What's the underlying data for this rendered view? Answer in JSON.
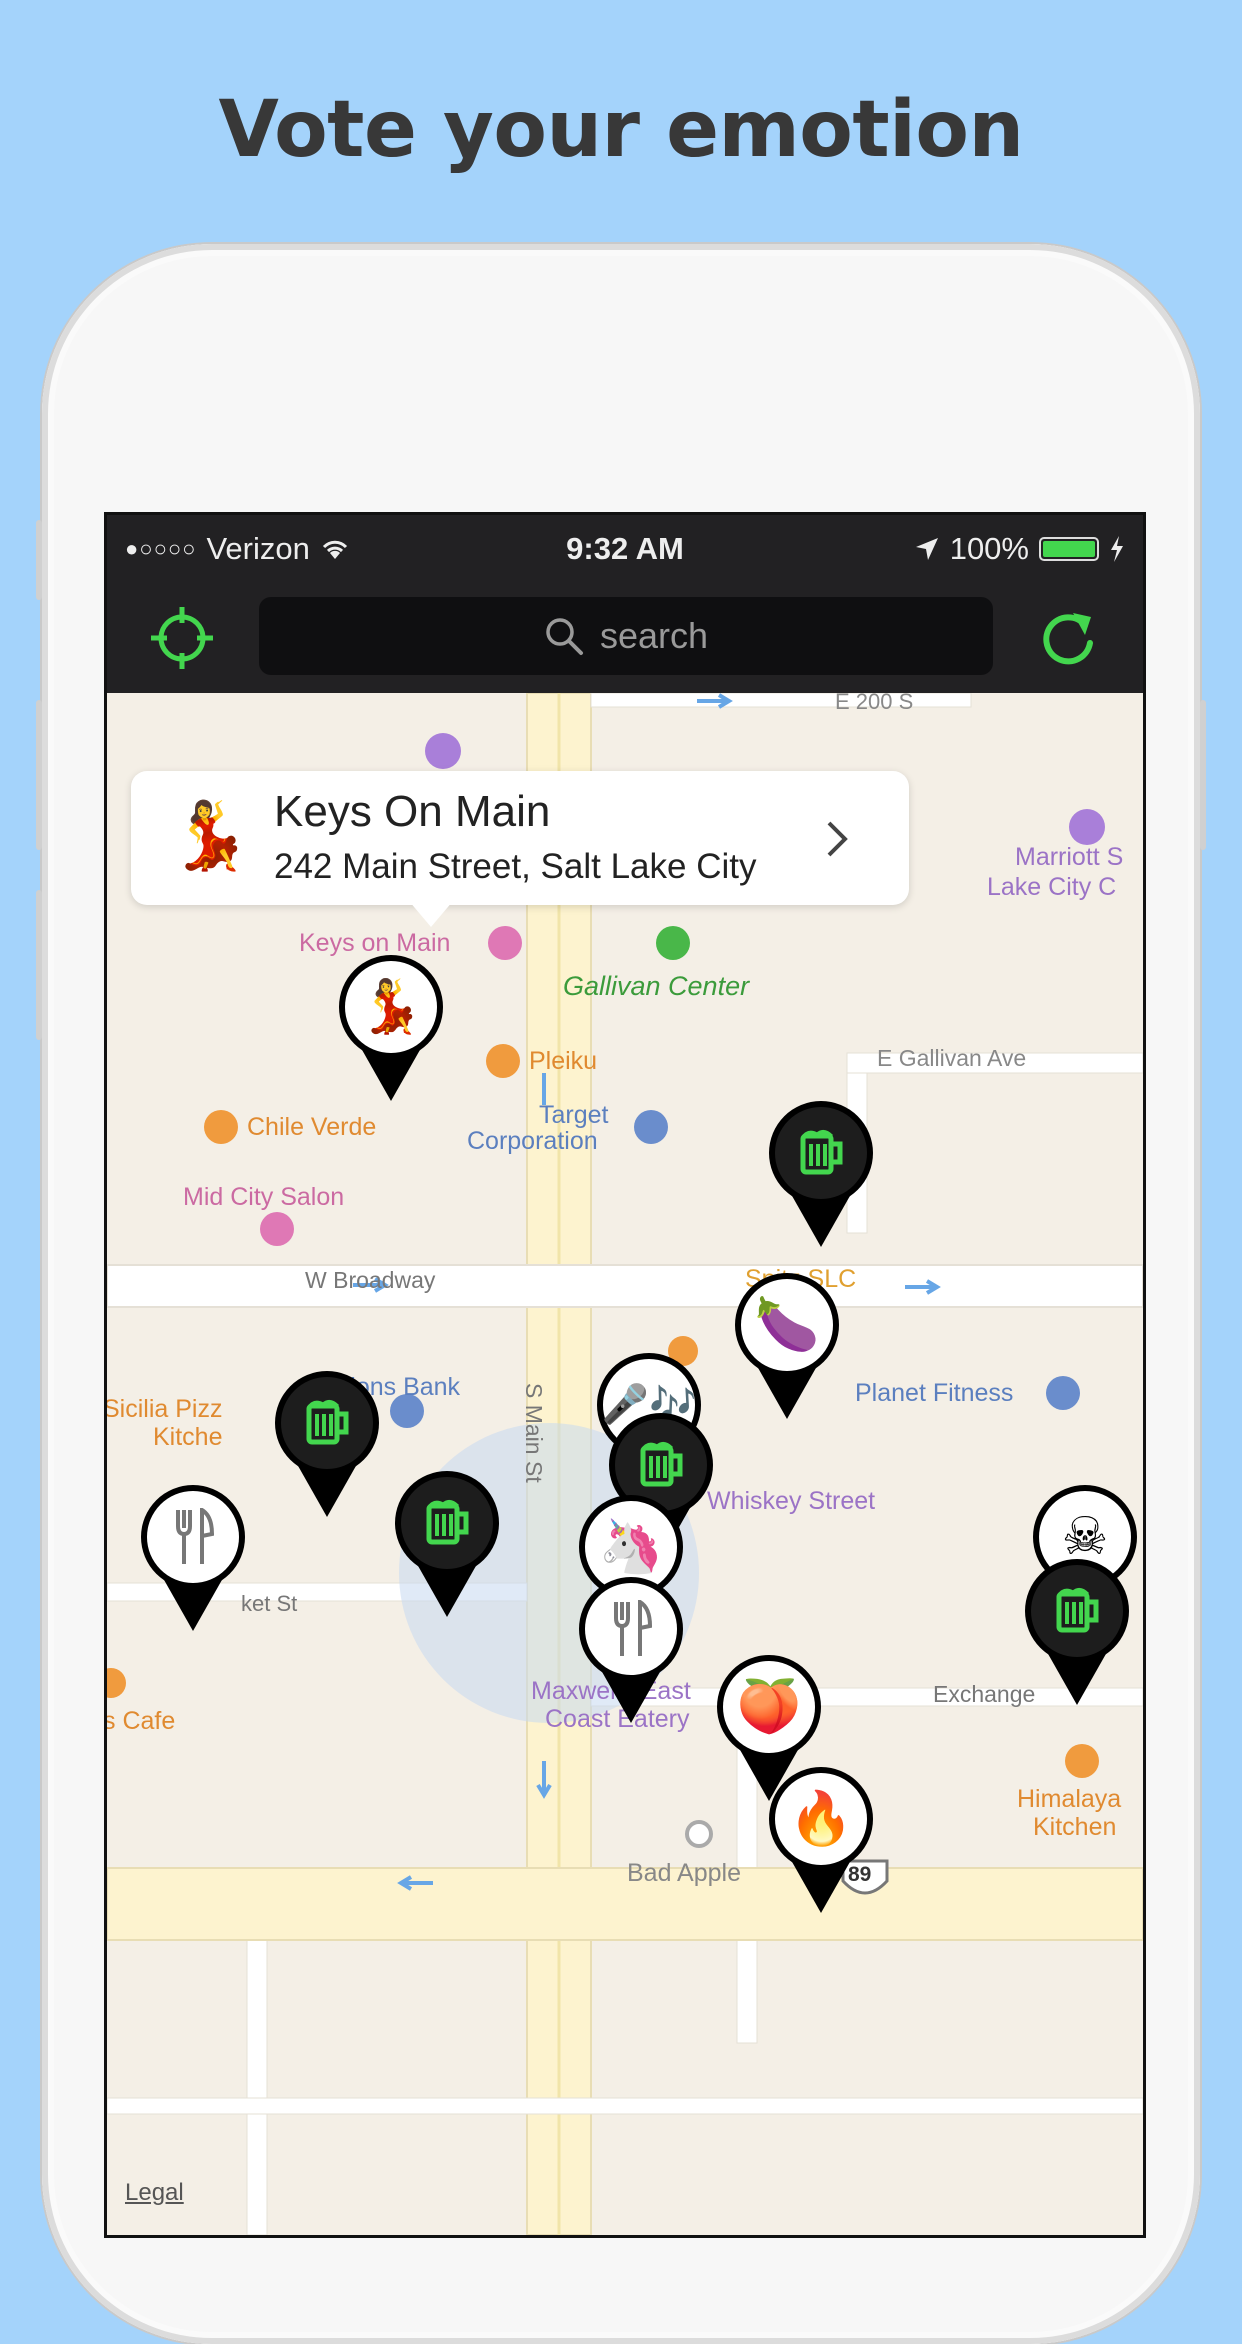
{
  "headline": "Vote your emotion",
  "status_bar": {
    "signal": "●○○○○",
    "carrier": "Verizon",
    "time": "9:32 AM",
    "battery": "100%",
    "battery_level": 1.0
  },
  "toolbar": {
    "locate_icon": "crosshair-icon",
    "search_placeholder": "search",
    "refresh_icon": "refresh-icon"
  },
  "callout": {
    "title": "Keys On Main",
    "address": "242 Main Street, Salt Lake City",
    "emoji": "💃"
  },
  "map": {
    "labels": {
      "street_top": "E 200 S",
      "marriott": "Marriott S",
      "lake_city": "Lake City C",
      "keys_on_main": "Keys on Main",
      "gallivan": "Gallivan Center",
      "pleiku": "Pleiku",
      "gallivan_ave": "E Gallivan Ave",
      "chile_verde": "Chile Verde",
      "target": "Target",
      "corporation": "Corporation",
      "mid_city_salon": "Mid City Salon",
      "w_broadway": "W Broadway",
      "spitz": "Spitz SLC",
      "zions_bank": "Zions Bank",
      "s_main_st": "S Main St",
      "sicilia": "Sicilia Pizz",
      "kitchen_left": "Kitche",
      "planet_fitness": "Planet Fitness",
      "whiskey_street": "Whiskey Street",
      "market_st": "ket St",
      "exchange": "Exchange",
      "cafe": "s Cafe",
      "maxwells": "Maxwells East",
      "coast_eatery": "Coast Eatery",
      "himalayan": "Himalaya",
      "himalayan_kitchen": "Kitchen",
      "bad_apple": "Bad Apple",
      "route": "89"
    },
    "legal": "Legal"
  },
  "pins": [
    {
      "id": "keys-on-main-pin",
      "emoji": "💃",
      "style": "white"
    },
    {
      "id": "beer-pin-1",
      "emoji": "beer",
      "style": "dark"
    },
    {
      "id": "eggplant-pin",
      "emoji": "🍆",
      "style": "white"
    },
    {
      "id": "beer-pin-2",
      "emoji": "beer",
      "style": "dark"
    },
    {
      "id": "music-pin",
      "emoji": "🎤🎶",
      "style": "white"
    },
    {
      "id": "beer-pin-3",
      "emoji": "beer",
      "style": "dark"
    },
    {
      "id": "unicorn-pin",
      "emoji": "🦄",
      "style": "white"
    },
    {
      "id": "fork-pin-1",
      "emoji": "fork",
      "style": "white"
    },
    {
      "id": "fork-pin-2",
      "emoji": "fork",
      "style": "white"
    },
    {
      "id": "beer-pin-4",
      "emoji": "beer",
      "style": "dark"
    },
    {
      "id": "peach-pin",
      "emoji": "🍑",
      "style": "white"
    },
    {
      "id": "fire-pin",
      "emoji": "🔥",
      "style": "white"
    },
    {
      "id": "skull-pin",
      "emoji": "☠",
      "style": "white"
    },
    {
      "id": "beer-pin-5",
      "emoji": "beer",
      "style": "dark"
    }
  ],
  "colors": {
    "background": "#a4d3fb",
    "accent_green": "#43d64e",
    "bar": "#222123",
    "map": "#f4efe6",
    "road": "#fdf3cf",
    "pin_dark": "#1d1d1d"
  }
}
